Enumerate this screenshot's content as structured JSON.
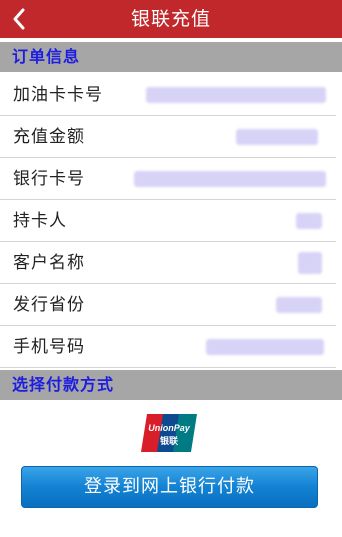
{
  "nav": {
    "title": "银联充值"
  },
  "order_section": {
    "title": "订单信息",
    "rows": [
      {
        "label": "加油卡卡号",
        "value": ""
      },
      {
        "label": "充值金额",
        "value": ""
      },
      {
        "label": "银行卡号",
        "value": ""
      },
      {
        "label": "持卡人",
        "value": ""
      },
      {
        "label": "客户名称",
        "value": ""
      },
      {
        "label": "发行省份",
        "value": ""
      },
      {
        "label": "手机号码",
        "value": ""
      }
    ]
  },
  "payment_section": {
    "title": "选择付款方式",
    "logo": {
      "text_top": "UnionPay",
      "text_bottom": "银联"
    },
    "button_label": "登录到网上银行付款"
  },
  "colors": {
    "nav_bar": "#c0282c",
    "section_header_bg": "#a6a6a6",
    "section_header_text": "#1d1de0",
    "button": "#1382d3"
  },
  "icons": {
    "back": "chevron-left-icon",
    "payment_logo": "unionpay-logo"
  }
}
